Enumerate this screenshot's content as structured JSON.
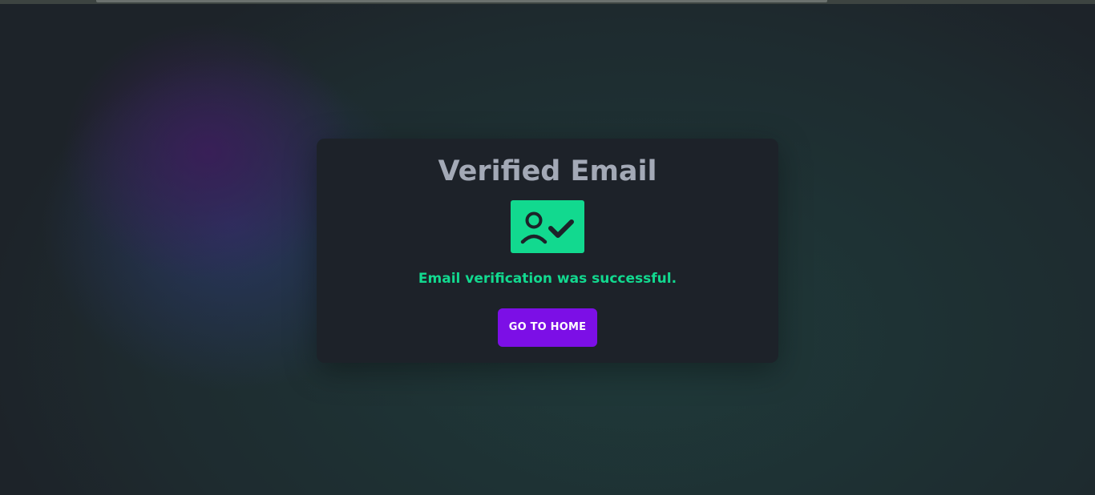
{
  "page": {
    "title": "Verified Email",
    "icon": "verified-user-icon",
    "message": "Email verification was successful.",
    "button_label": "GO TO HOME"
  },
  "colors": {
    "accent_green": "#12d98f",
    "button_purple": "#7c0fe6",
    "card_background": "#1d2229",
    "title_gray": "#a3a9b6"
  }
}
